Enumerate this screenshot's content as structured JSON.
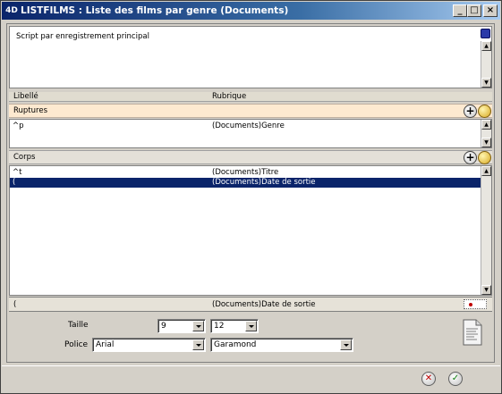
{
  "window": {
    "logo": "4D",
    "title": "LISTFILMS : Liste des films par genre (Documents)",
    "buttons": {
      "minimize": "_",
      "maximize": "□",
      "close": "×"
    }
  },
  "script": {
    "label": "Script par enregistrement principal"
  },
  "columns": {
    "libelle": "Libellé",
    "rubrique": "Rubrique"
  },
  "ruptures": {
    "label": "Ruptures",
    "rows": [
      {
        "libelle": "^p",
        "rubrique": "(Documents)Genre"
      }
    ]
  },
  "corps": {
    "label": "Corps",
    "rows": [
      {
        "libelle": "^t",
        "rubrique": "(Documents)Titre",
        "selected": false
      },
      {
        "libelle": "(",
        "rubrique": "(Documents)Date de sortie",
        "selected": true
      }
    ]
  },
  "footer": {
    "libelle": "(",
    "rubrique": "(Documents)Date de sortie"
  },
  "taille": {
    "label": "Taille",
    "value1": "9",
    "value2": "12"
  },
  "police": {
    "label": "Police",
    "value1": "Arial",
    "value2": "Garamond"
  },
  "icons": {
    "add": "+",
    "cancel": "✕",
    "validate": "✓"
  },
  "colors": {
    "selection": "#0a246a",
    "ruptures_bg": "#fde9d0",
    "titlebar": "#0a246a"
  }
}
